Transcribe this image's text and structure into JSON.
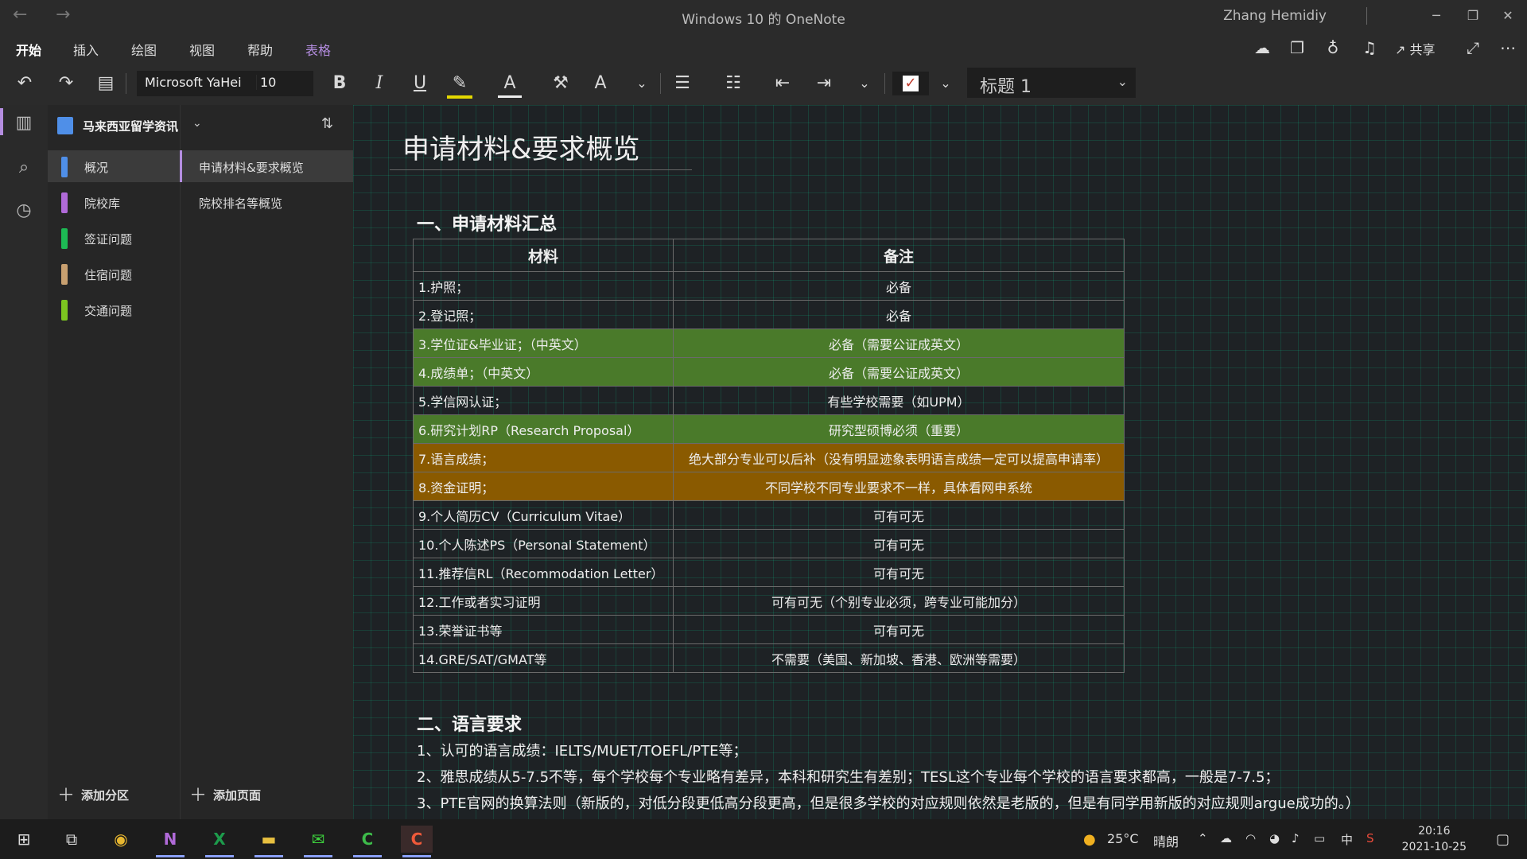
{
  "window": {
    "title": "Windows 10 的 OneNote",
    "user": "Zhang Hemidiy",
    "back_icon": "←",
    "forward_icon": "→",
    "minimize": "─",
    "restore": "❐",
    "close": "✕"
  },
  "ribbon": {
    "tabs": [
      "开始",
      "插入",
      "绘图",
      "视图",
      "帮助",
      "表格"
    ],
    "share_label": "共享",
    "font_name": "Microsoft YaHei",
    "font_size": "10",
    "style": "标题 1",
    "bold": "B",
    "italic": "I",
    "underline": "U"
  },
  "notebook": {
    "name": "马来西亚留学资讯",
    "sections": [
      {
        "label": "概况",
        "color": "#4f8fe8"
      },
      {
        "label": "院校库",
        "color": "#b06ad8"
      },
      {
        "label": "签证问题",
        "color": "#1db954"
      },
      {
        "label": "住宿问题",
        "color": "#c8a070"
      },
      {
        "label": "交通问题",
        "color": "#7cc520"
      }
    ],
    "pages": [
      "申请材料&要求概览",
      "院校排名等概览"
    ],
    "add_section": "添加分区",
    "add_page": "添加页面"
  },
  "page": {
    "title": "申请材料&要求概览",
    "h1": "一、申请材料汇总",
    "table": {
      "headers": [
        "材料",
        "备注"
      ],
      "rows": [
        {
          "material": "1.护照；",
          "note": "必备",
          "hl": ""
        },
        {
          "material": "2.登记照；",
          "note": "必备",
          "hl": ""
        },
        {
          "material": "3.学位证&毕业证；（中英文）",
          "note": "必备（需要公证成英文）",
          "hl": "green"
        },
        {
          "material": "4.成绩单；（中英文）",
          "note": "必备（需要公证成英文）",
          "hl": "green"
        },
        {
          "material": "5.学信网认证；",
          "note": "有些学校需要（如UPM）",
          "hl": ""
        },
        {
          "material": "6.研究计划RP（Research Proposal）",
          "note": "研究型硕博必须（重要）",
          "hl": "green"
        },
        {
          "material": "7.语言成绩；",
          "note": "绝大部分专业可以后补（没有明显迹象表明语言成绩一定可以提高申请率）",
          "hl": "orange"
        },
        {
          "material": "8.资金证明；",
          "note": "不同学校不同专业要求不一样，具体看网申系统",
          "hl": "orange"
        },
        {
          "material": "9.个人简历CV（Curriculum Vitae）",
          "note": "可有可无",
          "hl": ""
        },
        {
          "material": "10.个人陈述PS（Personal Statement）",
          "note": "可有可无",
          "hl": ""
        },
        {
          "material": "11.推荐信RL（Recommodation Letter）",
          "note": "可有可无",
          "hl": ""
        },
        {
          "material": "12.工作或者实习证明",
          "note": "可有可无（个别专业必须，跨专业可能加分）",
          "hl": ""
        },
        {
          "material": "13.荣誉证书等",
          "note": "可有可无",
          "hl": ""
        },
        {
          "material": "14.GRE/SAT/GMAT等",
          "note": "不需要（美国、新加坡、香港、欧洲等需要）",
          "hl": ""
        }
      ]
    },
    "h2": "二、语言要求",
    "paragraphs": [
      "1、认可的语言成绩：IELTS/MUET/TOEFL/PTE等；",
      "2、雅思成绩从5-7.5不等，每个学校每个专业略有差异，本科和研究生有差别；TESL这个专业每个学校的语言要求都高，一般是7-7.5；",
      "3、PTE官网的换算法则（新版的，对低分段更低高分段更高，但是很多学校的对应规则依然是老版的，但是有同学用新版的对应规则argue成功的。）"
    ]
  },
  "taskbar": {
    "weather_temp": "25°C",
    "weather_text": "晴朗",
    "ime": "中",
    "time": "20:16",
    "date": "2021-10-25"
  }
}
